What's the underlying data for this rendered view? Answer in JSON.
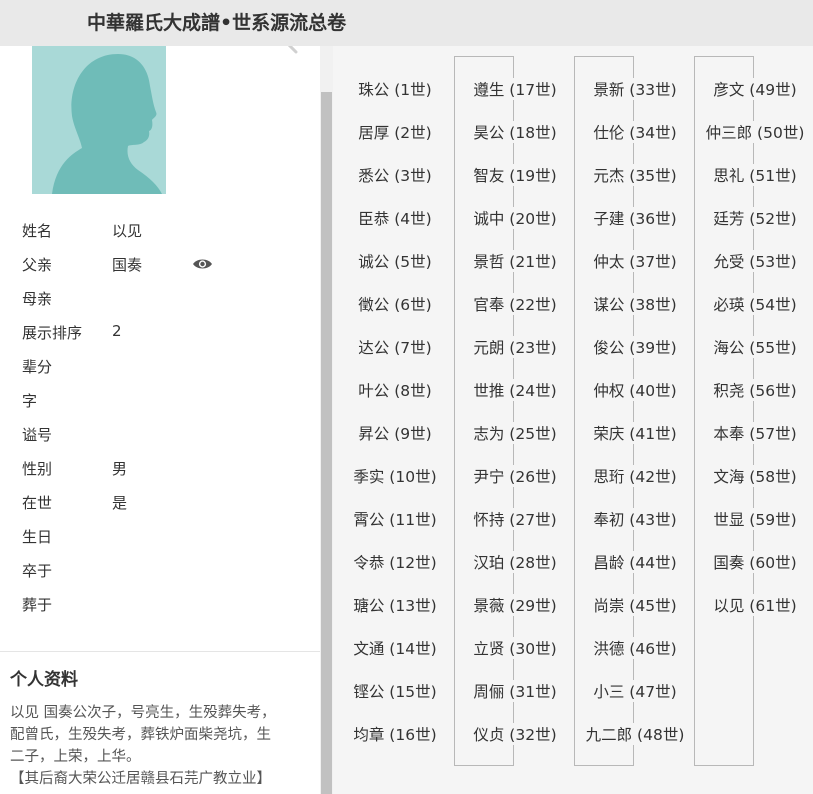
{
  "header": {
    "title": "中華羅氏大成譜•世系源流总卷"
  },
  "profile": {
    "fields": [
      {
        "label": "姓名",
        "value": "以见"
      },
      {
        "label": "父亲",
        "value": "国奏",
        "has_eye": true
      },
      {
        "label": "母亲",
        "value": ""
      },
      {
        "label": "展示排序",
        "value": "2"
      },
      {
        "label": "辈分",
        "value": ""
      },
      {
        "label": "字",
        "value": ""
      },
      {
        "label": "谥号",
        "value": ""
      },
      {
        "label": "性别",
        "value": "男"
      },
      {
        "label": "在世",
        "value": "是"
      },
      {
        "label": "生日",
        "value": ""
      },
      {
        "label": "卒于",
        "value": ""
      },
      {
        "label": "葬于",
        "value": ""
      }
    ]
  },
  "bio": {
    "title": "个人资料",
    "lines": [
      "以见 国奏公次子，号亮生，生殁葬失考，",
      "配曾氏，生殁失考，葬铁炉面柴尧坑，生",
      "二子，上荣，上华。",
      "【其后裔大荣公迁居赣县石芫广教立业】"
    ]
  },
  "generations": [
    [
      "珠公 (1世)",
      "居厚 (2世)",
      "悉公 (3世)",
      "臣恭 (4世)",
      "诚公 (5世)",
      "徵公 (6世)",
      "达公 (7世)",
      "叶公 (8世)",
      "昇公 (9世)",
      "季实 (10世)",
      "霄公 (11世)",
      "令恭 (12世)",
      "瑭公 (13世)",
      "文通 (14世)",
      "铿公 (15世)",
      "均章 (16世)"
    ],
    [
      "遵生 (17世)",
      "昊公 (18世)",
      "智友 (19世)",
      "诚中 (20世)",
      "景哲 (21世)",
      "官奉 (22世)",
      "元朗 (23世)",
      "世推 (24世)",
      "志为 (25世)",
      "尹宁 (26世)",
      "怀持 (27世)",
      "汉珀 (28世)",
      "景薇 (29世)",
      "立贤 (30世)",
      "周俪 (31世)",
      "仪贞 (32世)"
    ],
    [
      "景新 (33世)",
      "仕伦 (34世)",
      "元杰 (35世)",
      "子建 (36世)",
      "仲太 (37世)",
      "谋公 (38世)",
      "俊公 (39世)",
      "仲权 (40世)",
      "荣庆 (41世)",
      "思珩 (42世)",
      "奉初 (43世)",
      "昌龄 (44世)",
      "尚崇 (45世)",
      "洪德 (46世)",
      "小三 (47世)",
      "九二郎 (48世)"
    ],
    [
      "彦文 (49世)",
      "仲三郎 (50世)",
      "思礼 (51世)",
      "廷芳 (52世)",
      "允受 (53世)",
      "必瑛 (54世)",
      "海公 (55世)",
      "积尧 (56世)",
      "本奉 (57世)",
      "文海 (58世)",
      "世显 (59世)",
      "国奏 (60世)",
      "以见 (61世)"
    ]
  ]
}
